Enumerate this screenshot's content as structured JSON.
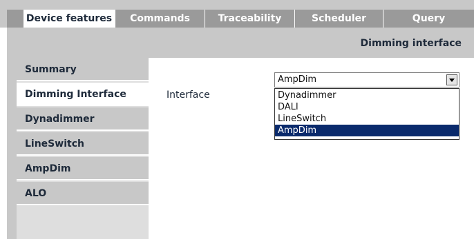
{
  "tabs": [
    {
      "label": "Device features",
      "active": true
    },
    {
      "label": "Commands",
      "active": false
    },
    {
      "label": "Traceability",
      "active": false
    },
    {
      "label": "Scheduler",
      "active": false
    },
    {
      "label": "Query",
      "active": false
    }
  ],
  "section_title": "Dimming interface",
  "menu": [
    {
      "label": "Summary",
      "active": false
    },
    {
      "label": "Dimming Interface",
      "active": true
    },
    {
      "label": "Dynadimmer",
      "active": false
    },
    {
      "label": "LineSwitch",
      "active": false
    },
    {
      "label": "AmpDim",
      "active": false
    },
    {
      "label": "ALO",
      "active": false
    }
  ],
  "interface_field": {
    "label": "Interface",
    "selected_value": "AmpDim",
    "options": [
      "Dynadimmer",
      "DALI",
      "LineSwitch",
      "AmpDim"
    ],
    "highlighted_option": "AmpDim"
  },
  "colors": {
    "tab_bg": "#9a9a9a",
    "panel_bg": "#c8c8c8",
    "selection": "#0a2a6c",
    "text_dark": "#1e2a3a"
  }
}
